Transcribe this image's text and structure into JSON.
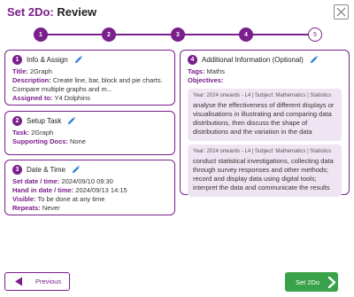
{
  "header": {
    "title_accent": "Set 2Do:",
    "title_main": "Review"
  },
  "stepper": [
    "1",
    "2",
    "3",
    "4",
    "5"
  ],
  "info": {
    "number": "1",
    "heading": "Info & Assign",
    "title_label": "Title:",
    "title_value": "2Graph",
    "description_label": "Description:",
    "description_value": "Create line, bar, block and pie charts. Compare multiple graphs and m...",
    "assigned_label": "Assigned to:",
    "assigned_value": "Y4 Dolphins"
  },
  "setup": {
    "number": "2",
    "heading": "Setup Task",
    "task_label": "Task:",
    "task_value": "2Graph",
    "docs_label": "Supporting Docs:",
    "docs_value": "None"
  },
  "datetime": {
    "number": "3",
    "heading": "Date & Time",
    "set_label": "Set date / time:",
    "set_value": "2024/09/10 09:30",
    "handin_label": "Hand in date / time:",
    "handin_value": "2024/09/13 14:15",
    "visible_label": "Visible:",
    "visible_value": "To be done at any time",
    "repeats_label": "Repeats:",
    "repeats_value": "Never"
  },
  "additional": {
    "number": "4",
    "heading": "Additional Information (Optional)",
    "tags_label": "Tags:",
    "tags_value": "Maths",
    "objectives_label": "Objectives:",
    "objectives": [
      {
        "meta": "Year: 2024 onwards - L4 | Subject: Mathematics | Statistics",
        "text": "analyse the effectiveness of different displays or visualisations in illustrating and comparing data distributions, then discuss the shape of distributions and the variation in the data"
      },
      {
        "meta": "Year: 2024 onwards - L4 | Subject: Mathematics | Statistics",
        "text": "conduct statistical investigations, collecting data through survey responses and other methods; record and display data using digital tools; interpret the data and communicate the results"
      }
    ]
  },
  "footer": {
    "previous_label": "Previous",
    "next_label": "Set 2Do"
  },
  "colors": {
    "accent": "#7a1f8c",
    "objective_bg": "#efe5f2",
    "primary_button": "#3aa24a",
    "edit_icon": "#2d7fd6"
  },
  "icons": {
    "close": "close-icon",
    "edit": "pencil-icon",
    "previous": "chevron-left-icon",
    "next": "chevron-right-icon"
  }
}
